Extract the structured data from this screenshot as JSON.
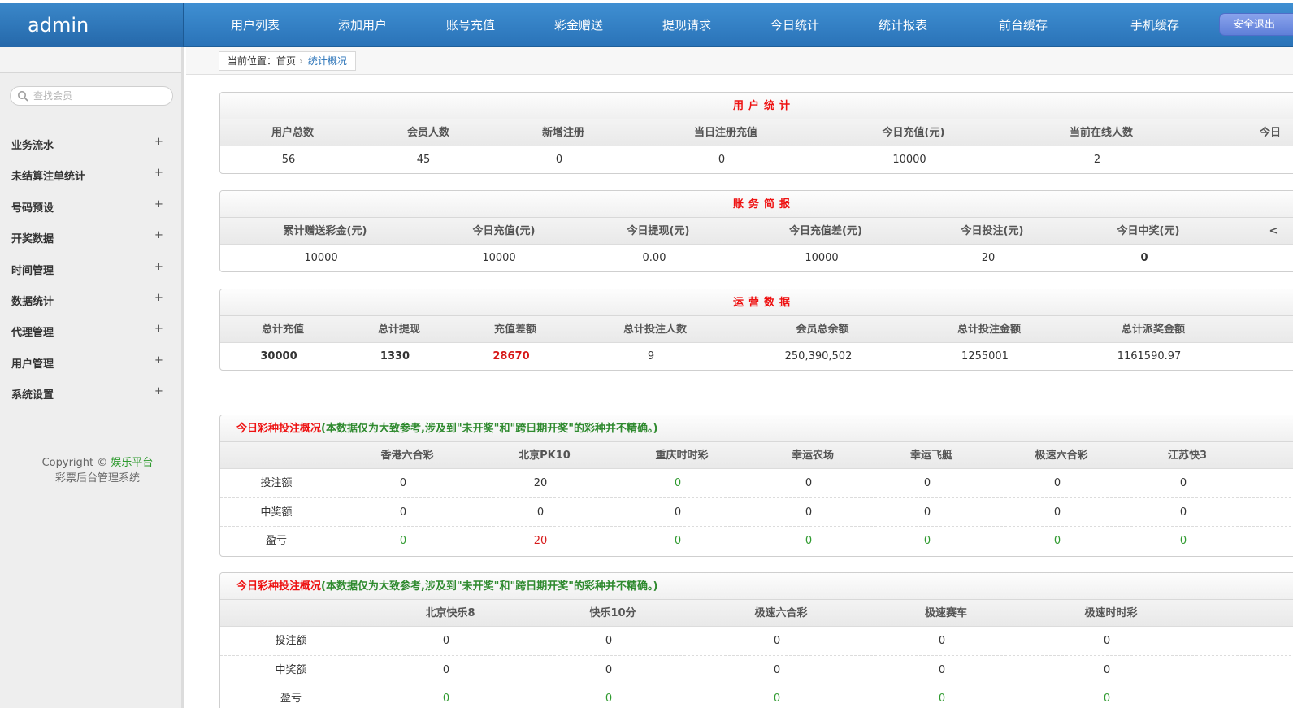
{
  "app": {
    "logo": "admin"
  },
  "nav": [
    "用户列表",
    "添加用户",
    "账号充值",
    "彩金赠送",
    "提现请求",
    "今日统计",
    "统计报表",
    "前台缓存",
    "手机缓存"
  ],
  "logout": "安全退出",
  "sidebar": {
    "search_placeholder": "查找会员",
    "items": [
      "业务流水",
      "未结算注单统计",
      "号码预设",
      "开奖数据",
      "时间管理",
      "数据统计",
      "代理管理",
      "用户管理",
      "系统设置"
    ],
    "plus": "+",
    "copyright": "Copyright ©",
    "brand": "娱乐平台",
    "subtitle": "彩票后台管理系统"
  },
  "breadcrumb": {
    "prefix": "当前位置：首页",
    "current": "统计概况"
  },
  "user_stats": {
    "title": "用户统计",
    "headers": [
      "用户总数",
      "会员人数",
      "新增注册",
      "当日注册充值",
      "今日充值(元)",
      "当前在线人数",
      "今日"
    ],
    "values": [
      "56",
      "45",
      "0",
      "0",
      "10000",
      "2",
      ""
    ]
  },
  "finance": {
    "title": "账务简报",
    "headers": [
      "累计赠送彩金(元)",
      "今日充值(元)",
      "今日提现(元)",
      "今日充值差(元)",
      "今日投注(元)",
      "今日中奖(元)",
      "<"
    ],
    "values": [
      "10000",
      "10000",
      "0.00",
      "10000",
      "20",
      "0",
      ""
    ]
  },
  "operations": {
    "title": "运营数据",
    "headers": [
      "总计充值",
      "总计提现",
      "充值差额",
      "总计投注人数",
      "会员总余额",
      "总计投注金额",
      "总计派奖金额"
    ],
    "values": [
      "30000",
      "1330",
      "28670",
      "9",
      "250,390,502",
      "1255001",
      "1161590.97"
    ]
  },
  "lottery1": {
    "title": "今日彩种投注概况",
    "note": "(本数据仅为大致参考,涉及到\"未开奖\"和\"跨日期开奖\"的彩种并不精确。)",
    "games": [
      "香港六合彩",
      "北京PK10",
      "重庆时时彩",
      "幸运农场",
      "幸运飞艇",
      "极速六合彩",
      "江苏快3"
    ],
    "rows": [
      {
        "label": "投注额",
        "values": [
          "0",
          "20",
          "0",
          "0",
          "0",
          "0",
          "0"
        ]
      },
      {
        "label": "中奖额",
        "values": [
          "0",
          "0",
          "0",
          "0",
          "0",
          "0",
          "0"
        ]
      },
      {
        "label": "盈亏",
        "values": [
          "0",
          "20",
          "0",
          "0",
          "0",
          "0",
          "0"
        ]
      }
    ]
  },
  "lottery2": {
    "title": "今日彩种投注概况",
    "note": "(本数据仅为大致参考,涉及到\"未开奖\"和\"跨日期开奖\"的彩种并不精确。)",
    "games": [
      "北京快乐8",
      "快乐10分",
      "极速六合彩",
      "极速赛车",
      "极速时时彩"
    ],
    "rows": [
      {
        "label": "投注额",
        "values": [
          "0",
          "0",
          "0",
          "0",
          "0"
        ]
      },
      {
        "label": "中奖额",
        "values": [
          "0",
          "0",
          "0",
          "0",
          "0"
        ]
      },
      {
        "label": "盈亏",
        "values": [
          "0",
          "0",
          "0",
          "0",
          "0"
        ]
      }
    ]
  },
  "colors": {
    "accent_red": "#d71818",
    "accent_green": "#2f9a2f",
    "nav_blue": "#2a73b8"
  }
}
